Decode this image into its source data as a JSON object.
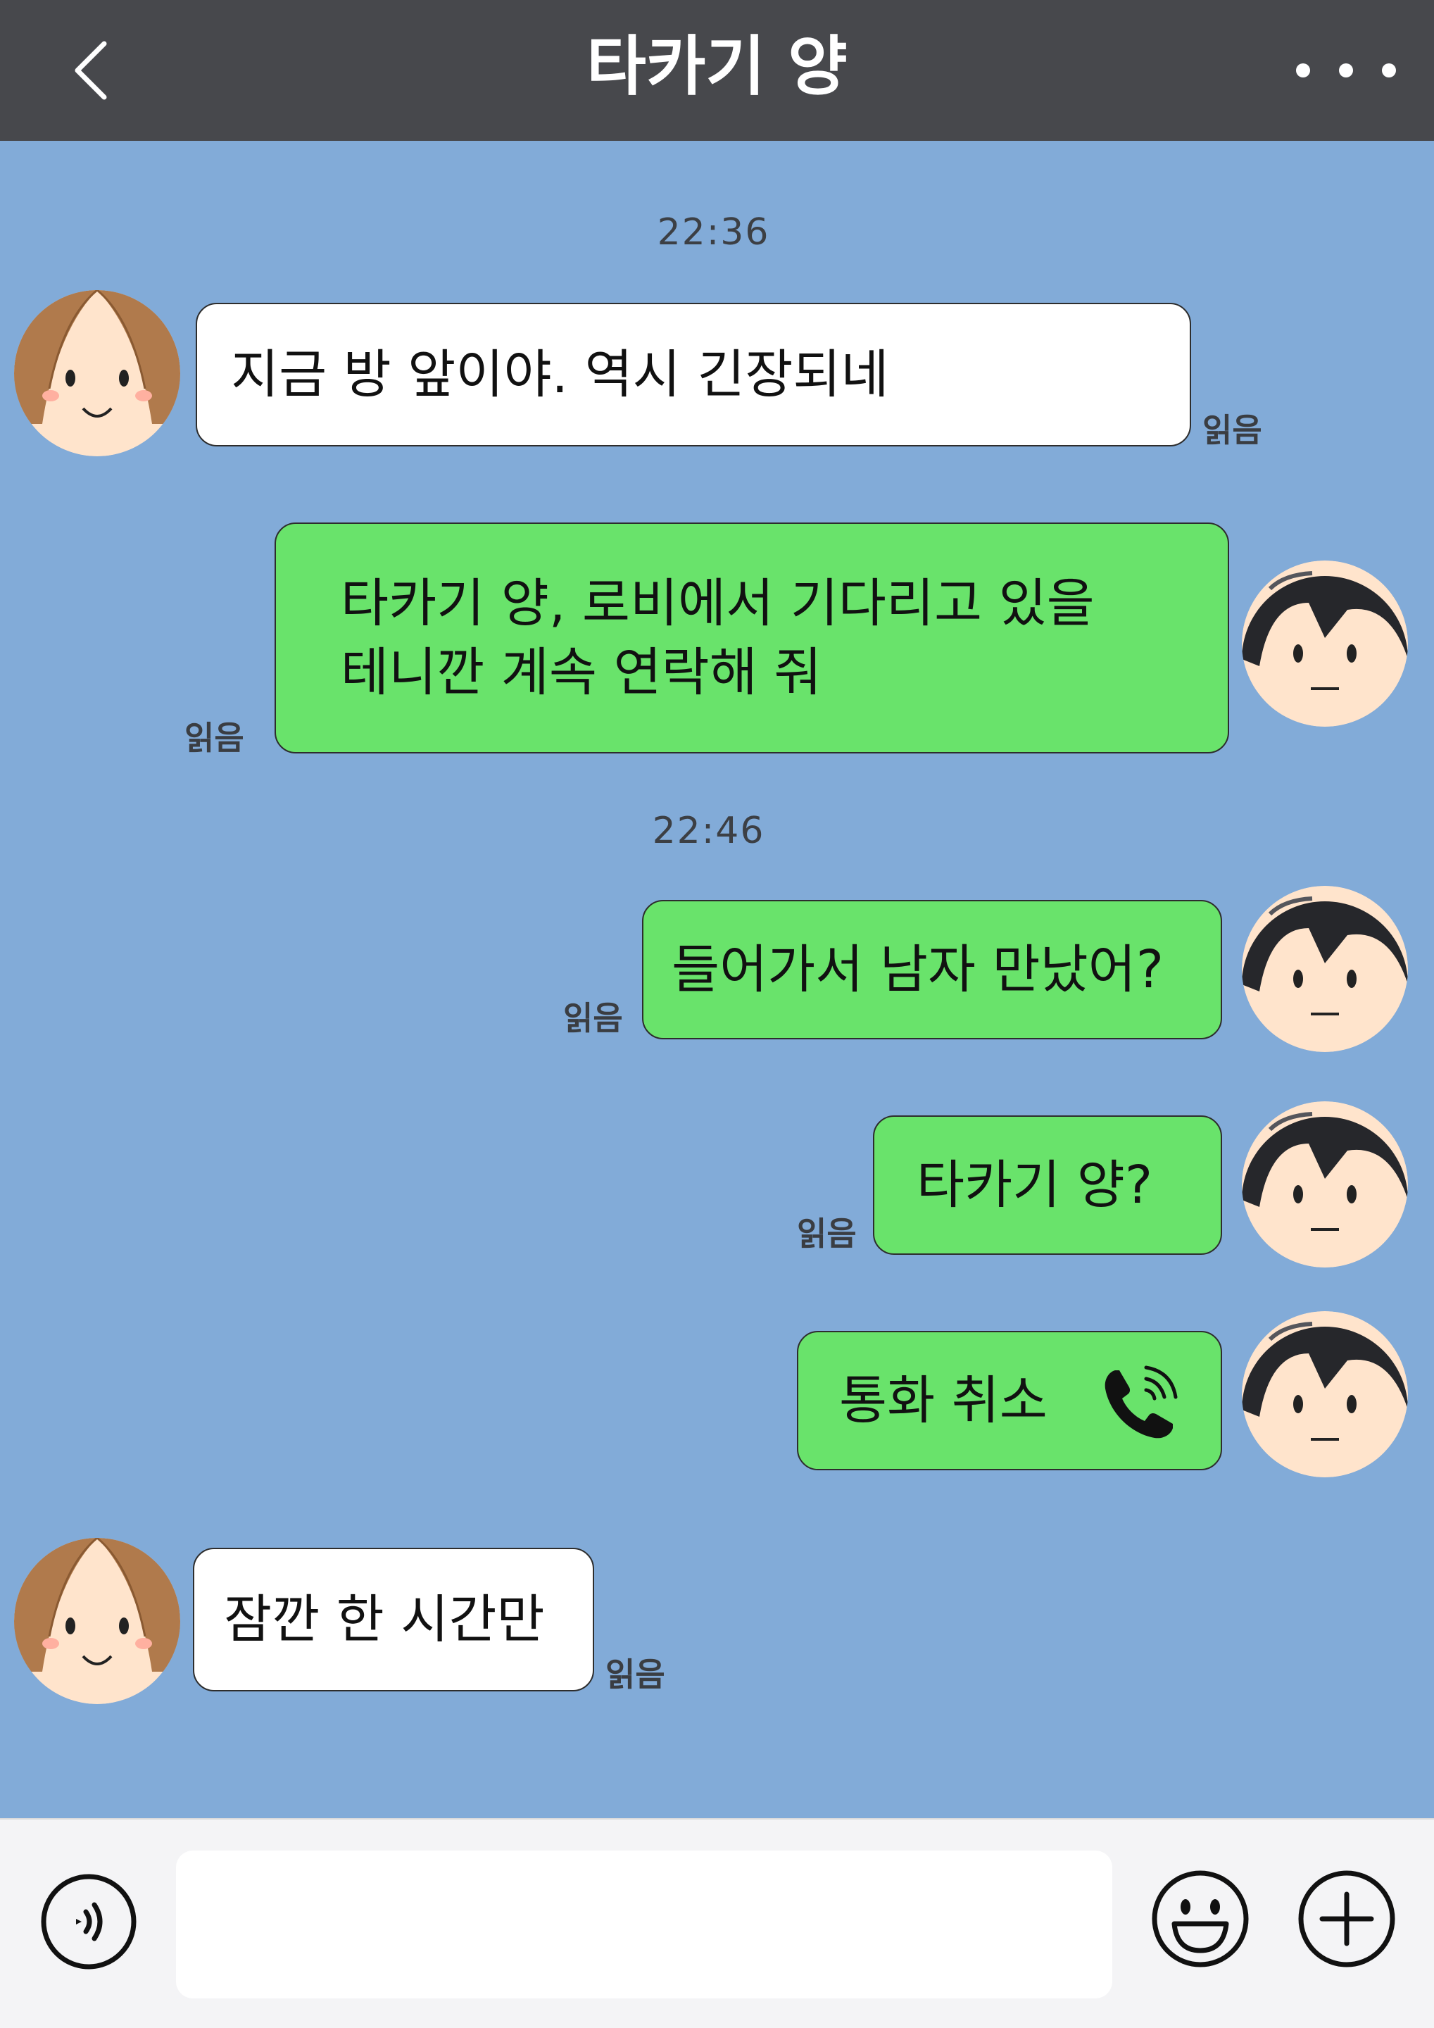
{
  "header": {
    "title": "타카기 양",
    "back_icon": "chevron-left-icon",
    "more_icon": "more-dots-icon"
  },
  "messages": [
    {
      "type": "time",
      "text": "22:36"
    },
    {
      "type": "incoming",
      "text": "지금 방 앞이야. 역시 긴장되네",
      "read": "읽음"
    },
    {
      "type": "outgoing",
      "text": "타카기 양, 로비에서 기다리고 있을\n테니깐 계속 연락해 줘",
      "read": "읽음"
    },
    {
      "type": "time",
      "text": "22:46"
    },
    {
      "type": "outgoing",
      "text": "들어가서 남자 만났어?",
      "read": "읽음"
    },
    {
      "type": "outgoing",
      "text": "타카기 양?",
      "read": "읽음"
    },
    {
      "type": "outgoing-call",
      "text": "통화 취소",
      "icon": "phone-icon"
    },
    {
      "type": "incoming",
      "text": "잠깐 한 시간만",
      "read": "읽음"
    }
  ],
  "input": {
    "voice_icon": "voice-icon",
    "emoji_icon": "emoji-icon",
    "plus_icon": "plus-icon"
  },
  "colors": {
    "header_bg": "#47484c",
    "chat_bg": "#82abd8",
    "bubble_in": "#ffffff",
    "bubble_out": "#69e36b",
    "bottom_bg": "#f4f4f6"
  }
}
